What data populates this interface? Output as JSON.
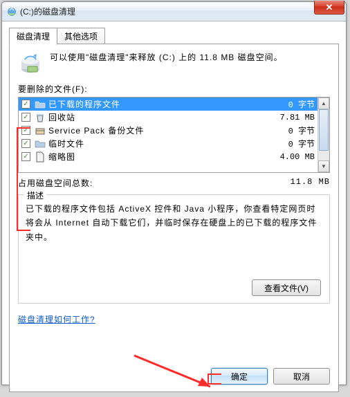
{
  "title": "(C:)的磁盘清理",
  "close_glyph": "✕",
  "tabs": {
    "cleanup": "磁盘清理",
    "other": "其他选项"
  },
  "info": "可以使用\"磁盘清理\"来释放  (C:) 上的 11.8 MB 磁盘空间。",
  "files_label": "要删除的文件(F):",
  "items": [
    {
      "name": "已下载的程序文件",
      "size": "0 字节",
      "checked": true,
      "selected": true,
      "icon": "folder"
    },
    {
      "name": "回收站",
      "size": "7.81 MB",
      "checked": true,
      "selected": false,
      "icon": "recycle"
    },
    {
      "name": "Service Pack 备份文件",
      "size": "0 字节",
      "checked": true,
      "selected": false,
      "icon": "box"
    },
    {
      "name": "临时文件",
      "size": "0 字节",
      "checked": true,
      "selected": false,
      "icon": "folder"
    },
    {
      "name": "缩略图",
      "size": "4.00 MB",
      "checked": true,
      "selected": false,
      "icon": "file"
    }
  ],
  "total_label": "占用磁盘空间总数:",
  "total_value": "11.8 MB",
  "desc_title": "描述",
  "desc_text": "已下载的程序文件包括 ActiveX 控件和 Java 小程序，你查看特定网页时将会从 Internet 自动下载它们，并临时保存在硬盘上的已下载的程序文件夹中。",
  "view_files": "查看文件(V)",
  "help_link": "磁盘清理如何工作?",
  "ok": "确定",
  "cancel": "取消",
  "scroll": {
    "up": "▲",
    "down": "▼"
  }
}
